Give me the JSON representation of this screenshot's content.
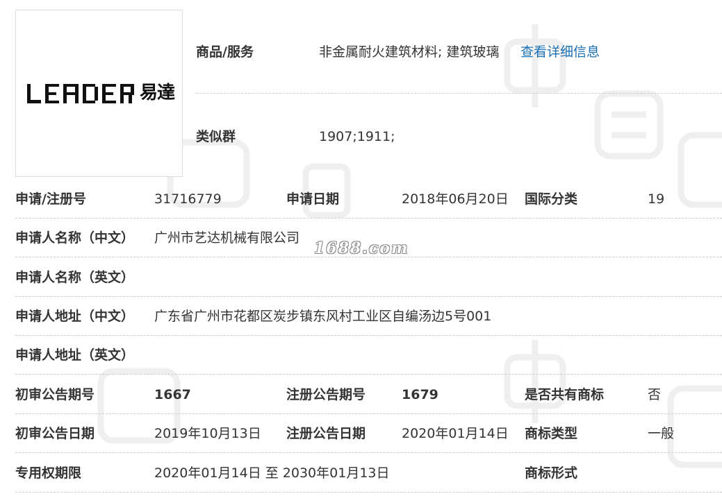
{
  "brand": {
    "latin": "LEADER",
    "chinese": "易達"
  },
  "watermark": "1688.com",
  "top": {
    "goods_label": "商品/服务",
    "goods_value": "非金属耐火建筑材料; 建筑玻璃",
    "detail_link": "查看详细信息",
    "group_label": "类似群",
    "group_value": "1907;1911;"
  },
  "rows": [
    {
      "c1": "申请/注册号",
      "c2": "31716779",
      "c3": "申请日期",
      "c4": "2018年06月20日",
      "c5": "国际分类",
      "c6": "19"
    },
    {
      "c1": "申请人名称（中文）",
      "c2": "广州市艺达机械有限公司"
    },
    {
      "c1": "申请人名称（英文）",
      "c2": ""
    },
    {
      "c1": "申请人地址（中文）",
      "c2": "广东省广州市花都区炭步镇东风村工业区自编汤边5号001"
    },
    {
      "c1": "申请人地址（英文）",
      "c2": ""
    },
    {
      "c1": "初审公告期号",
      "c2": "1667",
      "c3": "注册公告期号",
      "c4": "1679",
      "c5": "是否共有商标",
      "c6": "否"
    },
    {
      "c1": "初审公告日期",
      "c2": "2019年10月13日",
      "c3": "注册公告日期",
      "c4": "2020年01月14日",
      "c5": "商标类型",
      "c6": "一般"
    },
    {
      "c1": "专用权期限",
      "c2": "2020年01月14日 至 2030年01月13日",
      "c5": "商标形式",
      "c6": ""
    }
  ]
}
